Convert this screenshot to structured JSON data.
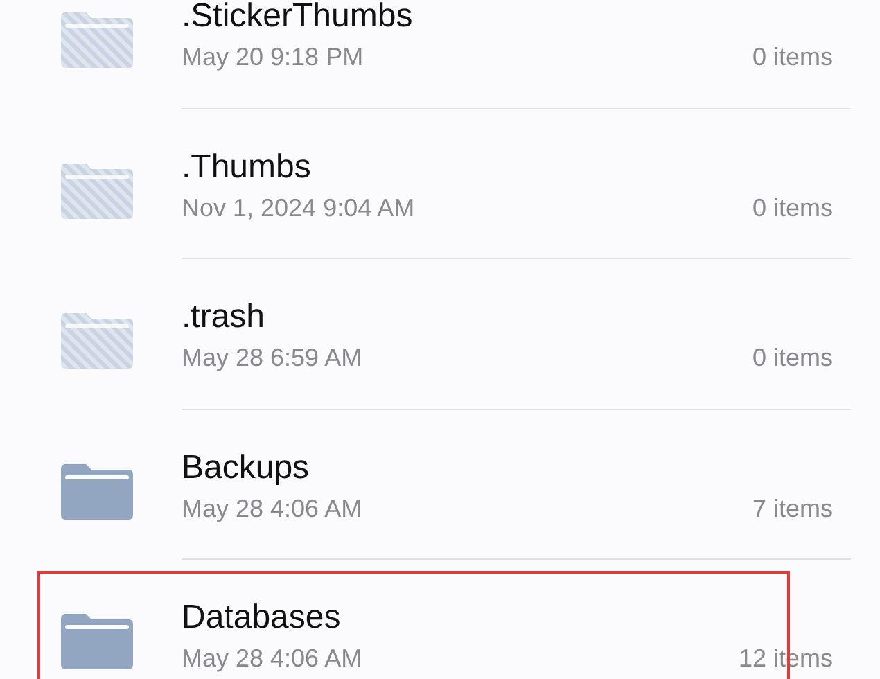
{
  "folders": [
    {
      "name": ".StickerThumbs",
      "date": "May 20 9:18 PM",
      "count": "0 items",
      "hidden": true,
      "selected": false
    },
    {
      "name": ".Thumbs",
      "date": "Nov 1, 2024 9:04 AM",
      "count": "0 items",
      "hidden": true,
      "selected": false
    },
    {
      "name": ".trash",
      "date": "May 28 6:59 AM",
      "count": "0 items",
      "hidden": true,
      "selected": false
    },
    {
      "name": "Backups",
      "date": "May 28 4:06 AM",
      "count": "7 items",
      "hidden": false,
      "selected": false
    },
    {
      "name": "Databases",
      "date": "May 28 4:06 AM",
      "count": "12 items",
      "hidden": false,
      "selected": true
    }
  ]
}
